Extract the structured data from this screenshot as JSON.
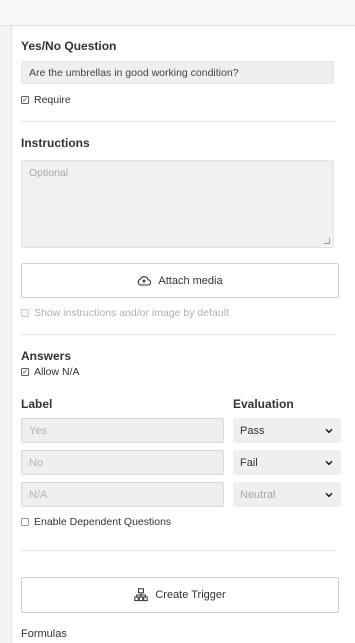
{
  "question": {
    "title": "Yes/No Question",
    "text": "Are the umbrellas in good working condition?",
    "require_label": "Require",
    "require_checked": true
  },
  "instructions": {
    "title": "Instructions",
    "placeholder": "Optional",
    "attach_label": "Attach media",
    "show_default_label": "Show instructions and/or image by default",
    "show_default_checked": false
  },
  "answers": {
    "title": "Answers",
    "allow_na_label": "Allow N/A",
    "allow_na_checked": true,
    "label_header": "Label",
    "evaluation_header": "Evaluation",
    "rows": [
      {
        "label_placeholder": "Yes",
        "evaluation": "Pass"
      },
      {
        "label_placeholder": "No",
        "evaluation": "Fail"
      },
      {
        "label_placeholder": "N/A",
        "evaluation": "Neutral"
      }
    ],
    "dependent_label": "Enable Dependent Questions",
    "dependent_checked": false
  },
  "trigger": {
    "label": "Create Trigger"
  },
  "formulas": {
    "title": "Formulas"
  },
  "icons": {
    "attach": "cloud-upload-icon",
    "trigger": "sitemap-icon",
    "select": "chevron-down-icon",
    "check": "checkmark-icon"
  }
}
